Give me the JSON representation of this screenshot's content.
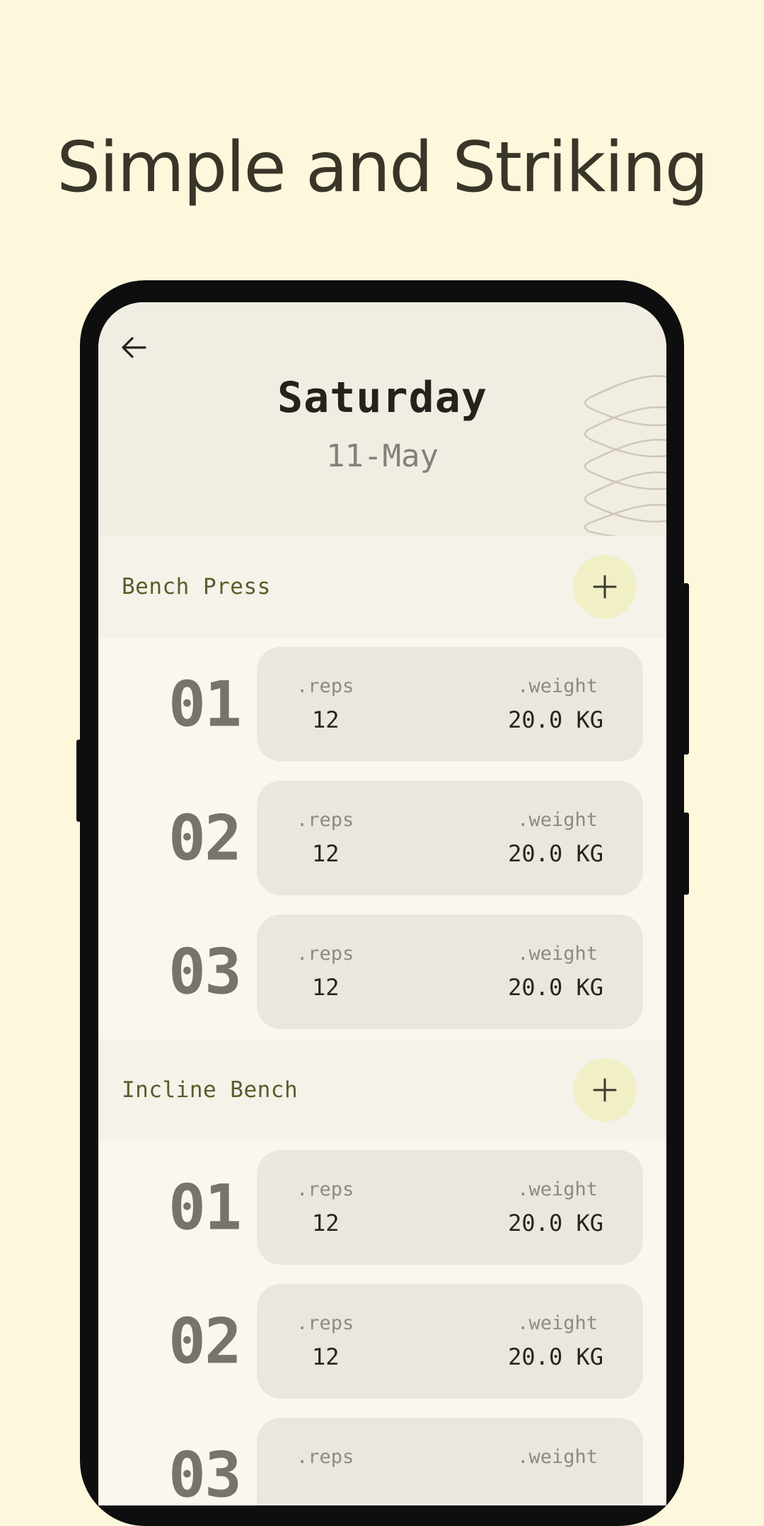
{
  "headline": "Simple and Striking",
  "header": {
    "day": "Saturday",
    "date": "11-May"
  },
  "exercises": [
    {
      "name": "Bench Press",
      "sets": [
        {
          "number": "01",
          "reps_label": ".reps",
          "reps": "12",
          "weight_label": ".weight",
          "weight": "20.0 KG"
        },
        {
          "number": "02",
          "reps_label": ".reps",
          "reps": "12",
          "weight_label": ".weight",
          "weight": "20.0 KG"
        },
        {
          "number": "03",
          "reps_label": ".reps",
          "reps": "12",
          "weight_label": ".weight",
          "weight": "20.0 KG"
        }
      ]
    },
    {
      "name": "Incline Bench",
      "sets": [
        {
          "number": "01",
          "reps_label": ".reps",
          "reps": "12",
          "weight_label": ".weight",
          "weight": "20.0 KG"
        },
        {
          "number": "02",
          "reps_label": ".reps",
          "reps": "12",
          "weight_label": ".weight",
          "weight": "20.0 KG"
        },
        {
          "number": "03",
          "reps_label": ".reps",
          "reps": "",
          "weight_label": ".weight",
          "weight": ""
        }
      ]
    }
  ],
  "icons": {
    "back": "arrow-left-icon",
    "add": "plus-icon"
  },
  "colors": {
    "background": "#fdf8dc",
    "add_button": "#f1efc6",
    "card": "#ebe6de",
    "section_label": "#5e5a2a"
  }
}
